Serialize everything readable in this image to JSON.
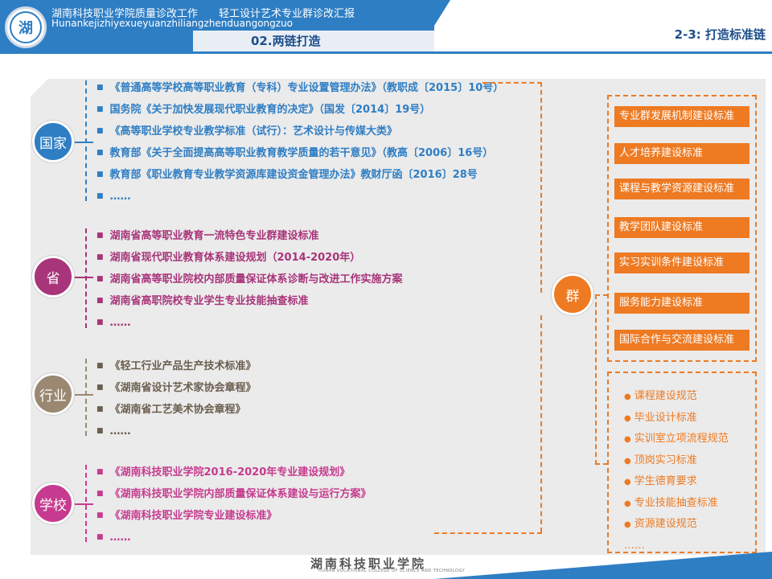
{
  "header": {
    "title": "湖南科技职业学院质量诊改工作　　轻工设计艺术专业群诊改汇报",
    "pinyin": "Hunankejizhiyexueyuanzhiliangzhenduangongzuo",
    "section": "02.两链打造",
    "page_tag": "2-3: 打造标准链"
  },
  "nodes": {
    "country": "国家",
    "province": "省",
    "industry": "行业",
    "school": "学校",
    "cluster": "群"
  },
  "country_items": [
    "《普通高等学校高等职业教育（专科）专业设置管理办法》（教职成〔2015〕10号）",
    "国务院《关于加快发展现代职业教育的决定》（国发〔2014〕19号）",
    "《高等职业学校专业教学标准（试行）：艺术设计与传媒大类》",
    "教育部《关于全面提高高等职业教育教学质量的若干意见》（教高〔2006〕16号）",
    "教育部《职业教育专业教学资源库建设资金管理办法》教财厅函〔2016〕28号",
    "……"
  ],
  "province_items": [
    "湖南省高等职业教育一流特色专业群建设标准",
    "湖南省现代职业教育体系建设规划（2014-2020年）",
    "湖南省高等职业院校内部质量保证体系诊断与改进工作实施方案",
    "湖南省高职院校专业学生专业技能抽查标准",
    "……"
  ],
  "industry_items": [
    "《轻工行业产品生产技术标准》",
    "《湖南省设计艺术家协会章程》",
    "《湖南省工艺美术协会章程》",
    "……"
  ],
  "school_items": [
    "《湖南科技职业学院2016-2020年专业建设规划》",
    "《湖南科技职业学院内部质量保证体系建设与运行方案》",
    "《湖南科技职业学院专业建设标准》",
    "……"
  ],
  "standards": [
    "专业群发展机制建设标准",
    "人才培养建设标准",
    "课程与教学资源建设标准",
    "教学团队建设标准",
    "实习实训条件建设标准",
    "服务能力建设标准",
    "国际合作与交流建设标准"
  ],
  "norms": [
    "课程建设规范",
    "毕业设计标准",
    "实训室立项流程规范",
    "顶岗实习标准",
    "学生德育要求",
    "专业技能抽查标准",
    "资源建设规范",
    "……"
  ],
  "bullet_square": "■",
  "bullet_dot": "●",
  "footer": {
    "logo": "湖南科技职业学院",
    "sub": "HUNAN VOCATIONAL COLLEGE OF SCIENCE AND TECHNOLOGY"
  },
  "colors": {
    "blue": "#2e7ec4",
    "purple": "#a8347a",
    "taupe": "#9a8872",
    "magenta": "#c63b8f",
    "orange": "#ee7a22"
  }
}
